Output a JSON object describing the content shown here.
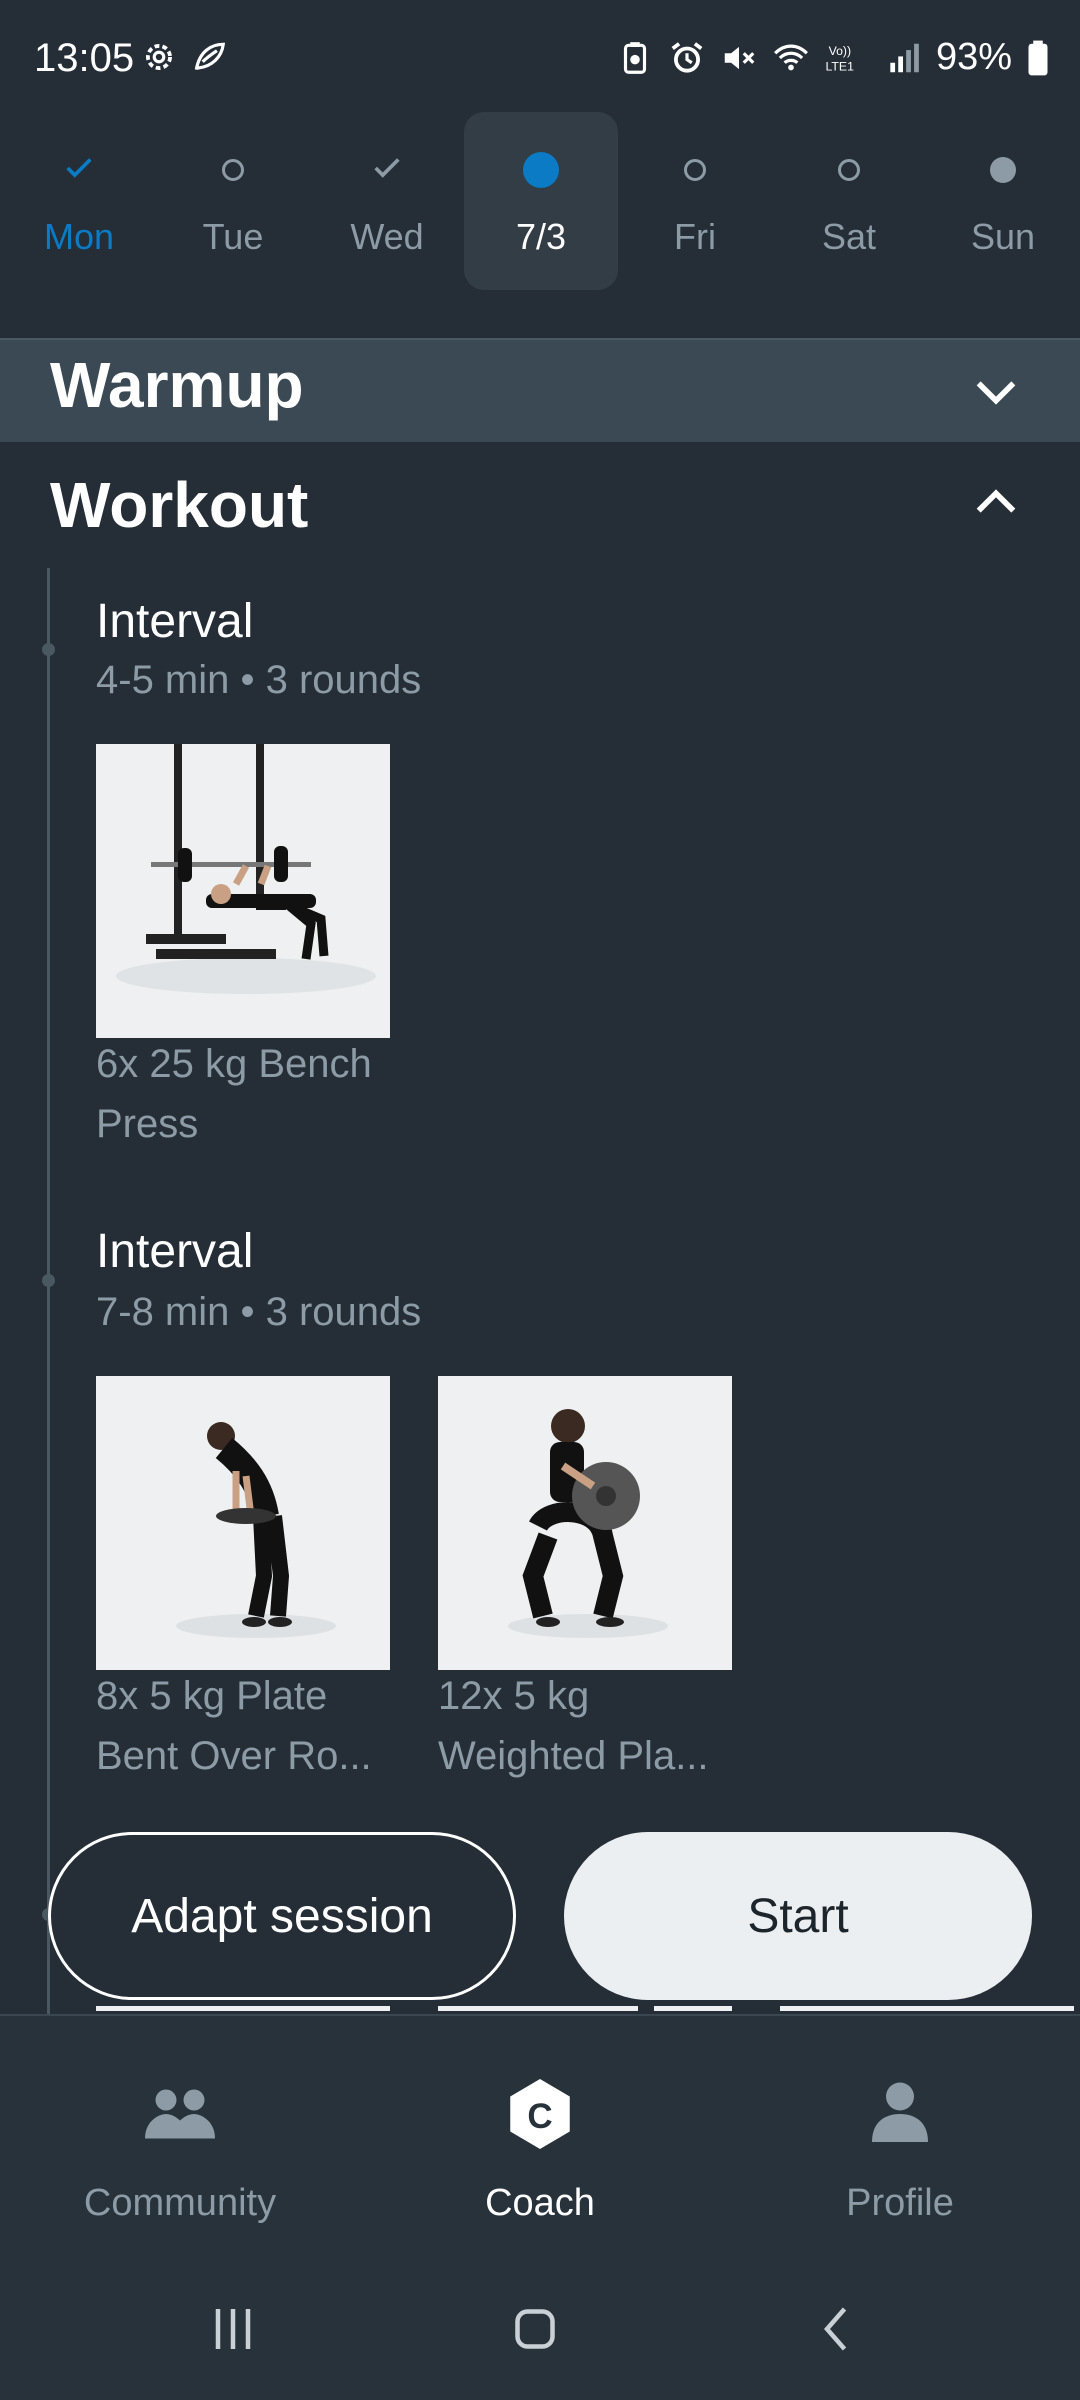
{
  "status_bar": {
    "time": "13:05",
    "battery": "93%",
    "left_icons": [
      "settings-gear-icon",
      "leaf-app-icon"
    ],
    "right_icons": [
      "battery-saver-icon",
      "alarm-icon",
      "mute-icon",
      "wifi-icon",
      "volte-icon",
      "signal-icon",
      "battery-icon"
    ],
    "volte_text": "Vo)) LTE1"
  },
  "days": [
    {
      "label": "Mon",
      "state": "done"
    },
    {
      "label": "Tue",
      "state": "todo"
    },
    {
      "label": "Wed",
      "state": "done-grey"
    },
    {
      "label": "7/3",
      "state": "selected"
    },
    {
      "label": "Fri",
      "state": "todo"
    },
    {
      "label": "Sat",
      "state": "todo"
    },
    {
      "label": "Sun",
      "state": "dot"
    }
  ],
  "sections": {
    "warmup": {
      "title": "Warmup",
      "expanded": false
    },
    "workout": {
      "title": "Workout",
      "expanded": true
    }
  },
  "intervals": [
    {
      "title": "Interval",
      "subtitle": "4-5 min • 3 rounds",
      "exercises": [
        {
          "line1": "6x 25 kg Bench",
          "line2": "Press"
        }
      ]
    },
    {
      "title": "Interval",
      "subtitle": "7-8 min • 3 rounds",
      "exercises": [
        {
          "line1": "8x 5 kg Plate",
          "line2": "Bent Over Ro..."
        },
        {
          "line1": "12x 5 kg",
          "line2": "Weighted Pla..."
        }
      ]
    }
  ],
  "actions": {
    "adapt_label": "Adapt session",
    "start_label": "Start"
  },
  "bottom_nav": [
    {
      "label": "Community",
      "icon": "community-icon",
      "active": false
    },
    {
      "label": "Coach",
      "icon": "coach-icon",
      "active": true
    },
    {
      "label": "Profile",
      "icon": "profile-icon",
      "active": false
    }
  ],
  "colors": {
    "background": "#252e36",
    "accent": "#0a7bc4",
    "muted_text": "#8c9ba5"
  }
}
